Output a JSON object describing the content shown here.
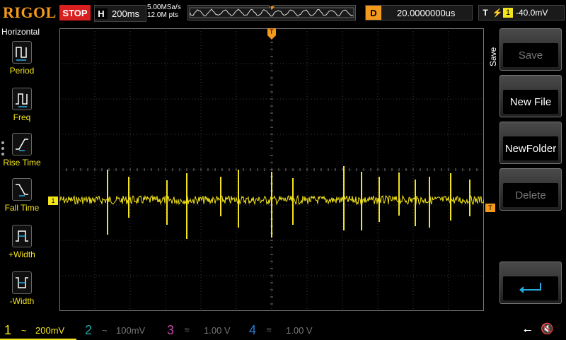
{
  "brand": {
    "logo": "RIGOL",
    "color": "#f39a1c"
  },
  "status": {
    "run_state": "STOP",
    "color": "#d82020"
  },
  "horizontal": {
    "label": "H",
    "timebase": "200ms"
  },
  "acquisition": {
    "sample_rate": "5.00MSa/s",
    "memory_depth": "12.0M pts"
  },
  "trigger_position_marker": "T",
  "delay": {
    "label": "D",
    "value": "20.0000000us"
  },
  "trigger": {
    "label": "T",
    "edge_icon": "rising-edge-icon",
    "source": "1",
    "level": "-40.0mV"
  },
  "left_menu": {
    "title": "Horizontal",
    "items": [
      {
        "label": "Period",
        "icon": "period-icon"
      },
      {
        "label": "Freq",
        "icon": "frequency-icon"
      },
      {
        "label": "Rise Time",
        "icon": "rise-time-icon"
      },
      {
        "label": "Fall Time",
        "icon": "fall-time-icon"
      },
      {
        "label": "+Width",
        "icon": "positive-width-icon"
      },
      {
        "label": "-Width",
        "icon": "negative-width-icon"
      }
    ]
  },
  "right_menu": {
    "title": "Save",
    "buttons": [
      {
        "label": "Save",
        "enabled": false
      },
      {
        "label": "New File",
        "enabled": true
      },
      {
        "label": "NewFolder",
        "enabled": true
      },
      {
        "label": "Delete",
        "enabled": false
      },
      {
        "label": "",
        "icon": "return-arrow-icon",
        "enabled": true
      }
    ]
  },
  "waveform": {
    "channel_marker": "1",
    "trigger_level_marker": "T",
    "color": "#f3e41c"
  },
  "channels": [
    {
      "num": "1",
      "coupling": "~",
      "scale": "200mV",
      "color": "#f3e41c",
      "active": true
    },
    {
      "num": "2",
      "coupling": "~",
      "scale": "100mV",
      "color": "#1ca6a6",
      "active": false
    },
    {
      "num": "3",
      "coupling": "",
      "scale": "1.00 V",
      "color": "#c04aa8",
      "active": false
    },
    {
      "num": "4",
      "coupling": "",
      "scale": "1.00 V",
      "color": "#2a7ad4",
      "active": false
    }
  ],
  "status_icons": [
    "usb-icon",
    "speaker-muted-icon"
  ]
}
